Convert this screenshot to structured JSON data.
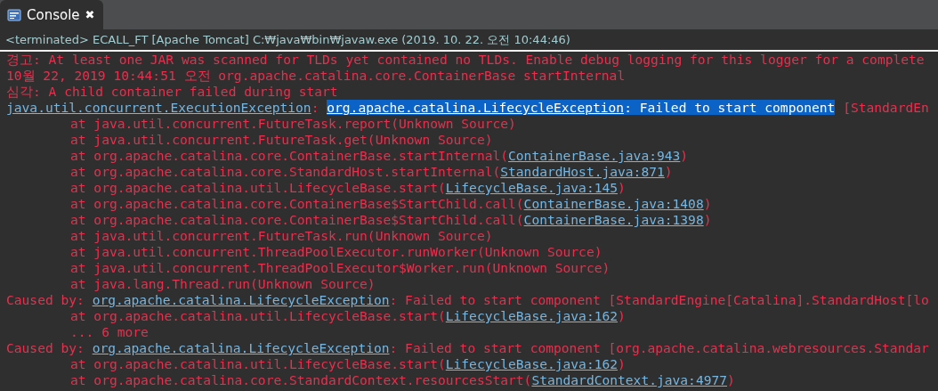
{
  "tab": {
    "label": "Console",
    "close": "✖",
    "selected": true
  },
  "header": "<terminated> ECALL_FT [Apache Tomcat] C:₩java₩bin₩javaw.exe (2019. 10. 22. 오전 10:44:46)",
  "lines": [
    {
      "indented": false,
      "segments": [
        {
          "kind": "text",
          "text": "경고: At least one JAR was scanned for TLDs yet contained no TLDs. Enable debug logging for this logger for a complete"
        }
      ]
    },
    {
      "indented": false,
      "segments": [
        {
          "kind": "text",
          "text": "10월 22, 2019 10:44:51 오전 org.apache.catalina.core.ContainerBase startInternal"
        }
      ]
    },
    {
      "indented": false,
      "segments": [
        {
          "kind": "text",
          "text": "심각: A child container failed during start"
        }
      ]
    },
    {
      "indented": false,
      "segments": [
        {
          "kind": "link",
          "text": "java.util.concurrent.ExecutionException"
        },
        {
          "kind": "text",
          "text": ": "
        },
        {
          "kind": "selected_link",
          "text": "org.apache.catalina.LifecycleException"
        },
        {
          "kind": "selected",
          "text": ": Failed to start component"
        },
        {
          "kind": "text",
          "text": " [StandardEn"
        }
      ]
    },
    {
      "indented": true,
      "segments": [
        {
          "kind": "text",
          "text": "at java.util.concurrent.FutureTask.report(Unknown Source)"
        }
      ]
    },
    {
      "indented": true,
      "segments": [
        {
          "kind": "text",
          "text": "at java.util.concurrent.FutureTask.get(Unknown Source)"
        }
      ]
    },
    {
      "indented": true,
      "segments": [
        {
          "kind": "text",
          "text": "at org.apache.catalina.core.ContainerBase.startInternal("
        },
        {
          "kind": "link",
          "text": "ContainerBase.java:943"
        },
        {
          "kind": "text",
          "text": ")"
        }
      ]
    },
    {
      "indented": true,
      "segments": [
        {
          "kind": "text",
          "text": "at org.apache.catalina.core.StandardHost.startInternal("
        },
        {
          "kind": "link",
          "text": "StandardHost.java:871"
        },
        {
          "kind": "text",
          "text": ")"
        }
      ]
    },
    {
      "indented": true,
      "segments": [
        {
          "kind": "text",
          "text": "at org.apache.catalina.util.LifecycleBase.start("
        },
        {
          "kind": "link",
          "text": "LifecycleBase.java:145"
        },
        {
          "kind": "text",
          "text": ")"
        }
      ]
    },
    {
      "indented": true,
      "segments": [
        {
          "kind": "text",
          "text": "at org.apache.catalina.core.ContainerBase$StartChild.call("
        },
        {
          "kind": "link",
          "text": "ContainerBase.java:1408"
        },
        {
          "kind": "text",
          "text": ")"
        }
      ]
    },
    {
      "indented": true,
      "segments": [
        {
          "kind": "text",
          "text": "at org.apache.catalina.core.ContainerBase$StartChild.call("
        },
        {
          "kind": "link",
          "text": "ContainerBase.java:1398"
        },
        {
          "kind": "text",
          "text": ")"
        }
      ]
    },
    {
      "indented": true,
      "segments": [
        {
          "kind": "text",
          "text": "at java.util.concurrent.FutureTask.run(Unknown Source)"
        }
      ]
    },
    {
      "indented": true,
      "segments": [
        {
          "kind": "text",
          "text": "at java.util.concurrent.ThreadPoolExecutor.runWorker(Unknown Source)"
        }
      ]
    },
    {
      "indented": true,
      "segments": [
        {
          "kind": "text",
          "text": "at java.util.concurrent.ThreadPoolExecutor$Worker.run(Unknown Source)"
        }
      ]
    },
    {
      "indented": true,
      "segments": [
        {
          "kind": "text",
          "text": "at java.lang.Thread.run(Unknown Source)"
        }
      ]
    },
    {
      "indented": false,
      "segments": [
        {
          "kind": "text",
          "text": "Caused by: "
        },
        {
          "kind": "link",
          "text": "org.apache.catalina.LifecycleException"
        },
        {
          "kind": "text",
          "text": ": Failed to start component [StandardEngine[Catalina].StandardHost[lo"
        }
      ]
    },
    {
      "indented": true,
      "segments": [
        {
          "kind": "text",
          "text": "at org.apache.catalina.util.LifecycleBase.start("
        },
        {
          "kind": "link",
          "text": "LifecycleBase.java:162"
        },
        {
          "kind": "text",
          "text": ")"
        }
      ]
    },
    {
      "indented": true,
      "segments": [
        {
          "kind": "text",
          "text": "... 6 more"
        }
      ]
    },
    {
      "indented": false,
      "segments": [
        {
          "kind": "text",
          "text": "Caused by: "
        },
        {
          "kind": "link",
          "text": "org.apache.catalina.LifecycleException"
        },
        {
          "kind": "text",
          "text": ": Failed to start component [org.apache.catalina.webresources.Standar"
        }
      ]
    },
    {
      "indented": true,
      "segments": [
        {
          "kind": "text",
          "text": "at org.apache.catalina.util.LifecycleBase.start("
        },
        {
          "kind": "link",
          "text": "LifecycleBase.java:162"
        },
        {
          "kind": "text",
          "text": ")"
        }
      ]
    },
    {
      "indented": true,
      "segments": [
        {
          "kind": "text",
          "text": "at org.apache.catalina.core.StandardContext.resourcesStart("
        },
        {
          "kind": "link",
          "text": "StandardContext.java:4977"
        },
        {
          "kind": "text",
          "text": ")"
        }
      ]
    }
  ]
}
